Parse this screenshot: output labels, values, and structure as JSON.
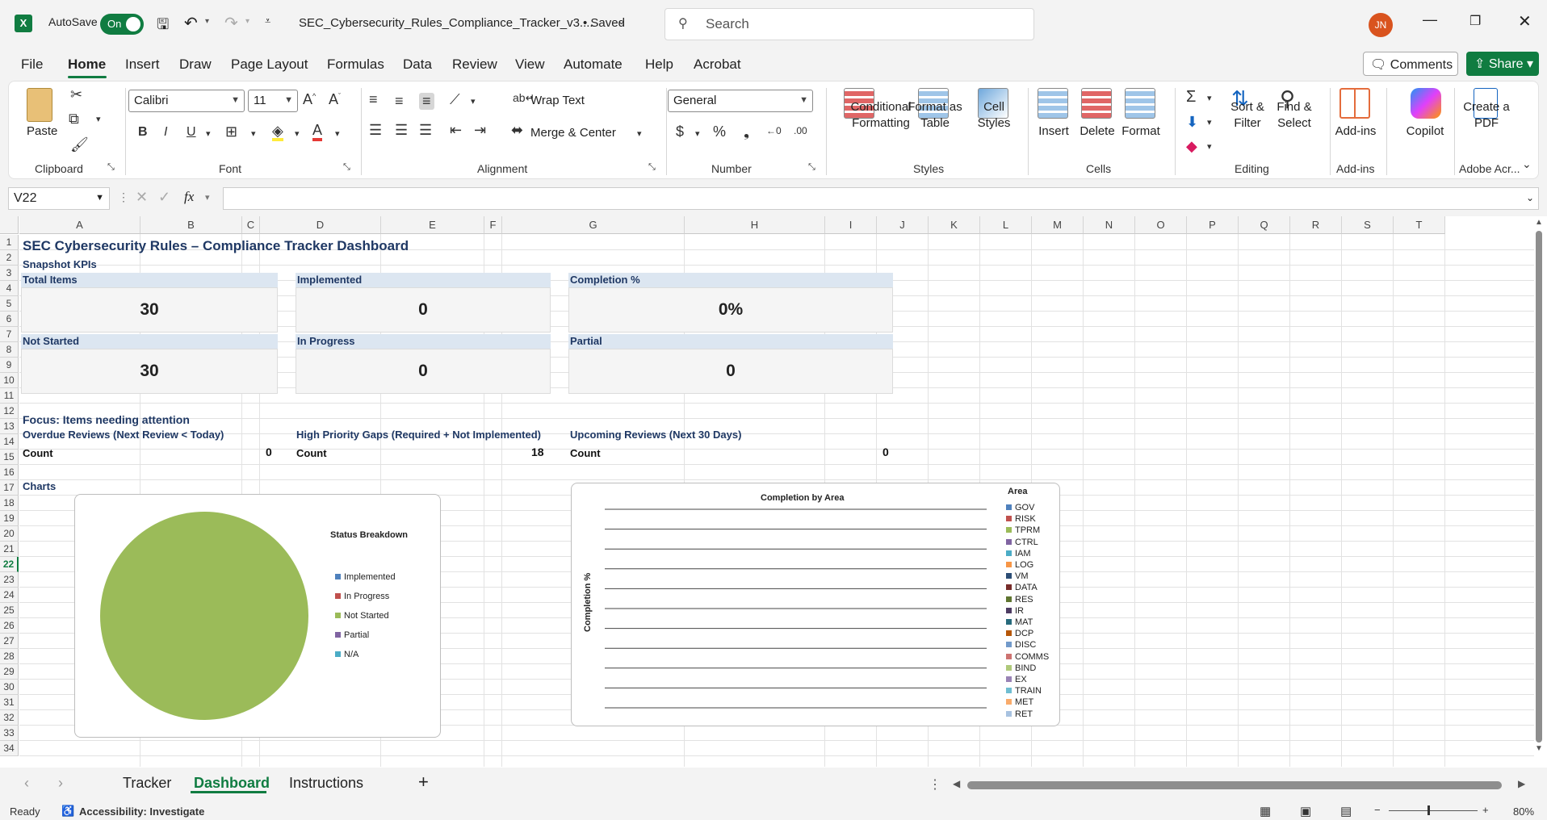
{
  "titlebar": {
    "autosave_label": "AutoSave",
    "autosave_state": "On",
    "filename": "SEC_Cybersecurity_Rules_Compliance_Tracker_v3....",
    "save_status": "• Saved",
    "search_placeholder": "Search",
    "user_initials": "JN"
  },
  "menu": {
    "items": [
      "File",
      "Home",
      "Insert",
      "Draw",
      "Page Layout",
      "Formulas",
      "Data",
      "Review",
      "View",
      "Automate",
      "Help",
      "Acrobat"
    ],
    "active": "Home",
    "comments_label": "Comments",
    "share_label": "Share"
  },
  "ribbon": {
    "paste_label": "Paste",
    "font_name": "Calibri",
    "font_size": "11",
    "wrap_text": "Wrap Text",
    "merge_center": "Merge & Center",
    "number_format": "General",
    "conditional_formatting": "Conditional Formatting",
    "format_as_table": "Format as Table",
    "cell_styles": "Cell Styles",
    "insert": "Insert",
    "delete": "Delete",
    "format": "Format",
    "sort_filter": "Sort & Filter",
    "find_select": "Find & Select",
    "add_ins": "Add-ins",
    "copilot": "Copilot",
    "create_pdf": "Create a PDF",
    "groups": {
      "clipboard": "Clipboard",
      "font": "Font",
      "alignment": "Alignment",
      "number": "Number",
      "styles": "Styles",
      "cells": "Cells",
      "editing": "Editing",
      "addins": "Add-ins",
      "adobe": "Adobe Acr..."
    }
  },
  "formula_bar": {
    "name_box": "V22",
    "fx": "fx",
    "content": ""
  },
  "columns": [
    "A",
    "B",
    "C",
    "D",
    "E",
    "F",
    "G",
    "H",
    "I",
    "J",
    "K",
    "L",
    "M",
    "N",
    "O",
    "P",
    "Q",
    "R",
    "S",
    "T"
  ],
  "rows": [
    "1",
    "2",
    "3",
    "4",
    "5",
    "6",
    "7",
    "8",
    "9",
    "10",
    "11",
    "12",
    "13",
    "14",
    "15",
    "16",
    "17",
    "18",
    "19",
    "20",
    "21",
    "22",
    "23",
    "24",
    "25",
    "26",
    "27",
    "28",
    "29",
    "30",
    "31",
    "32",
    "33",
    "34"
  ],
  "sheet": {
    "title": "SEC Cybersecurity Rules – Compliance Tracker Dashboard",
    "snapshot_label": "Snapshot KPIs",
    "kpis": [
      {
        "label": "Total Items",
        "value": "30"
      },
      {
        "label": "Implemented",
        "value": "0"
      },
      {
        "label": "Completion %",
        "value": "0%"
      },
      {
        "label": "Not Started",
        "value": "30"
      },
      {
        "label": "In Progress",
        "value": "0"
      },
      {
        "label": "Partial",
        "value": "0"
      }
    ],
    "focus_label": "Focus: Items needing attention",
    "focus": [
      {
        "label": "Overdue Reviews (Next Review < Today)",
        "count_label": "Count",
        "count": "0"
      },
      {
        "label": "High Priority Gaps (Required + Not Implemented)",
        "count_label": "Count",
        "count": "18"
      },
      {
        "label": "Upcoming Reviews (Next 30 Days)",
        "count_label": "Count",
        "count": "0"
      }
    ],
    "charts_label": "Charts"
  },
  "chart_data": [
    {
      "type": "pie",
      "title": "Status Breakdown",
      "categories": [
        "Implemented",
        "In Progress",
        "Not Started",
        "Partial",
        "N/A"
      ],
      "values": [
        0,
        0,
        30,
        0,
        0
      ],
      "colors": [
        "#4f81bd",
        "#c0504d",
        "#9bbb59",
        "#8064a2",
        "#4bacc6"
      ],
      "legend": "right"
    },
    {
      "type": "bar",
      "title": "Completion by Area",
      "ylabel": "Completion %",
      "legend_title": "Area",
      "categories": [],
      "series": [
        {
          "name": "GOV",
          "values": [],
          "color": "#4f81bd"
        },
        {
          "name": "RISK",
          "values": [],
          "color": "#c0504d"
        },
        {
          "name": "TPRM",
          "values": [],
          "color": "#9bbb59"
        },
        {
          "name": "CTRL",
          "values": [],
          "color": "#8064a2"
        },
        {
          "name": "IAM",
          "values": [],
          "color": "#4bacc6"
        },
        {
          "name": "LOG",
          "values": [],
          "color": "#f79646"
        },
        {
          "name": "VM",
          "values": [],
          "color": "#2c4d75"
        },
        {
          "name": "DATA",
          "values": [],
          "color": "#772c2a"
        },
        {
          "name": "RES",
          "values": [],
          "color": "#5f7530"
        },
        {
          "name": "IR",
          "values": [],
          "color": "#4d3b62"
        },
        {
          "name": "MAT",
          "values": [],
          "color": "#276a7c"
        },
        {
          "name": "DCP",
          "values": [],
          "color": "#b65708"
        },
        {
          "name": "DISC",
          "values": [],
          "color": "#729aca"
        },
        {
          "name": "COMMS",
          "values": [],
          "color": "#cd7371"
        },
        {
          "name": "BIND",
          "values": [],
          "color": "#afc97a"
        },
        {
          "name": "EX",
          "values": [],
          "color": "#9983b5"
        },
        {
          "name": "TRAIN",
          "values": [],
          "color": "#6fbdd1"
        },
        {
          "name": "MET",
          "values": [],
          "color": "#f9ab6b"
        },
        {
          "name": "RET",
          "values": [],
          "color": "#a8c2e0"
        }
      ],
      "grid": true,
      "legend": "right"
    }
  ],
  "sheet_tabs": [
    "Tracker",
    "Dashboard",
    "Instructions"
  ],
  "active_tab": "Dashboard",
  "status": {
    "ready": "Ready",
    "accessibility": "Accessibility: Investigate",
    "zoom": "80%"
  }
}
